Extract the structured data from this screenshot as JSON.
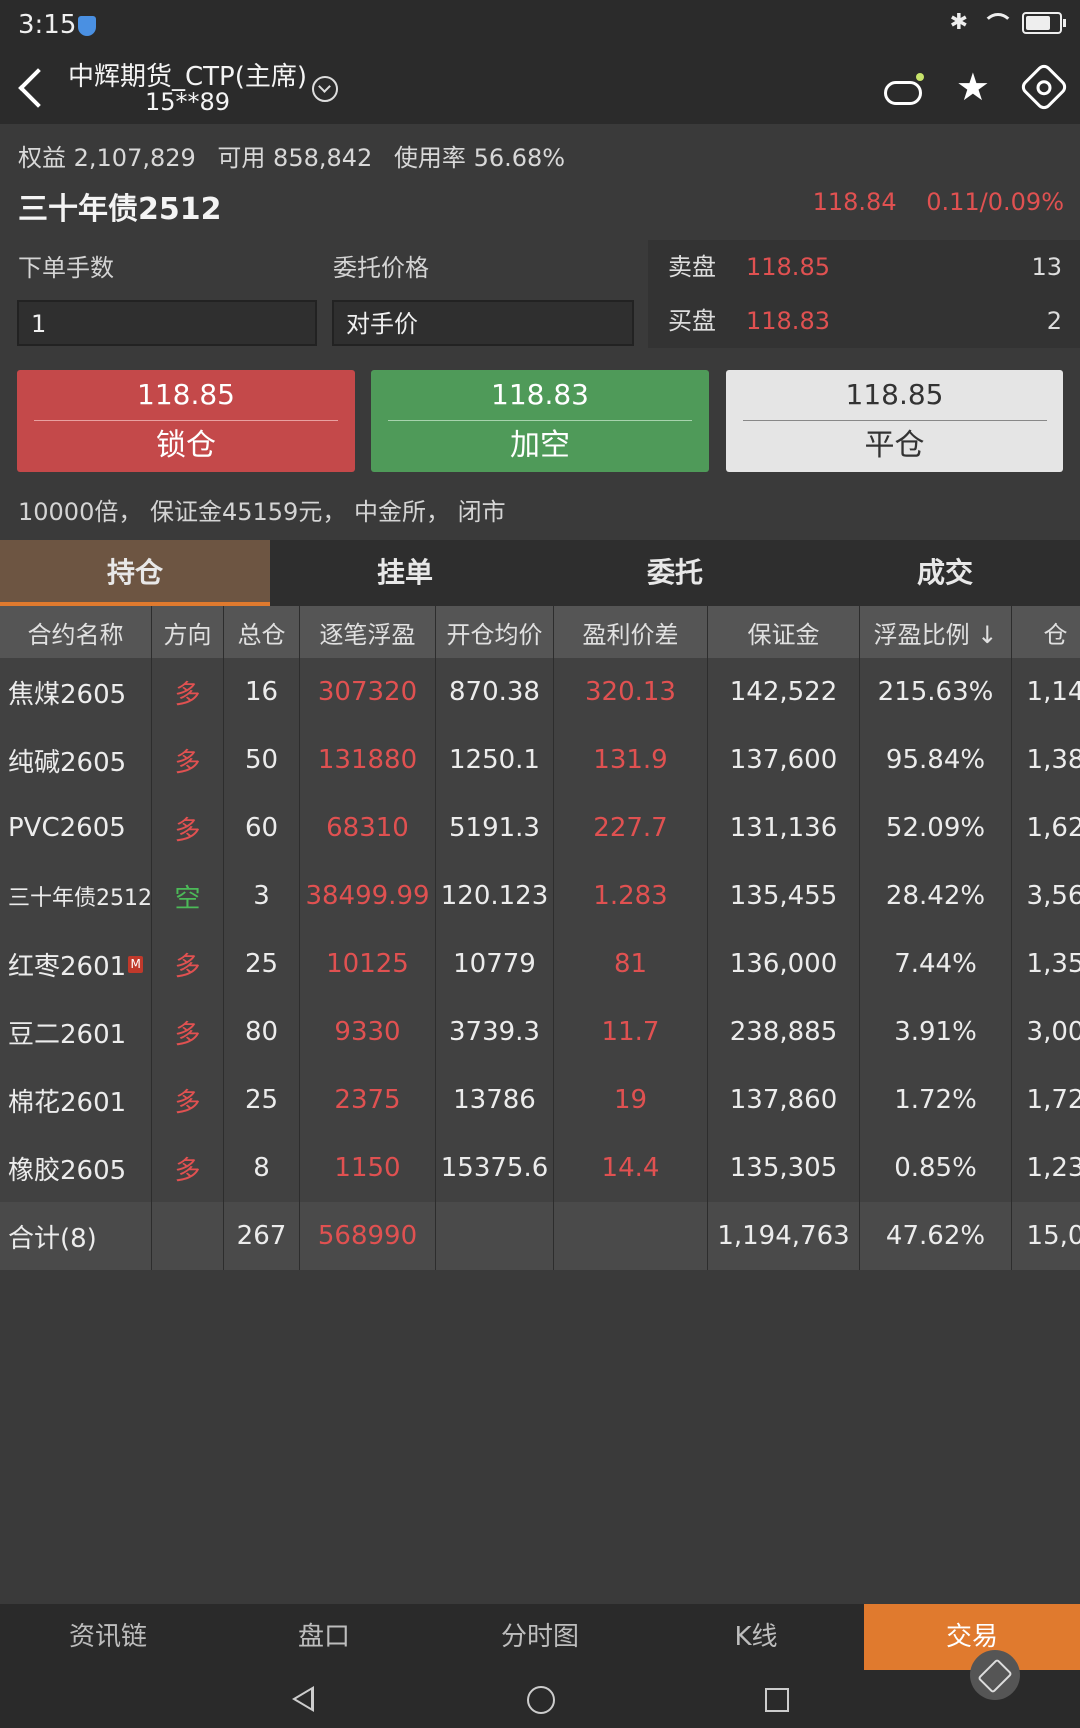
{
  "status": {
    "time": "3:15"
  },
  "nav": {
    "account_name": "中辉期货_CTP(主席)",
    "account_id": "15**89"
  },
  "account": {
    "equity": "权益 2,107,829",
    "available": "可用 858,842",
    "usage": "使用率 56.68%"
  },
  "contract": {
    "name": "三十年债2512",
    "last": "118.84",
    "change": "0.11/0.09%"
  },
  "order": {
    "lots_label": "下单手数",
    "price_label": "委托价格",
    "lots_value": "1",
    "price_value": "对手价"
  },
  "orderbook": {
    "ask": {
      "label": "卖盘",
      "price": "118.85",
      "volume": "13"
    },
    "bid": {
      "label": "买盘",
      "price": "118.83",
      "volume": "2"
    }
  },
  "buttons": {
    "lock": {
      "price": "118.85",
      "label": "锁仓"
    },
    "short": {
      "price": "118.83",
      "label": "加空"
    },
    "close": {
      "price": "118.85",
      "label": "平仓"
    }
  },
  "info": "10000倍， 保证金45159元， 中金所， 闭市",
  "tabs": [
    "持仓",
    "挂单",
    "委托",
    "成交"
  ],
  "table": {
    "headers": [
      "合约名称",
      "方向",
      "总仓",
      "逐笔浮盈",
      "开仓均价",
      "盈利价差",
      "保证金",
      "浮盈比例 ↓",
      "仓"
    ],
    "rows": [
      [
        "焦煤2605",
        "多",
        "16",
        "307320",
        "870.38",
        "320.13",
        "142,522",
        "215.63%",
        "1,14"
      ],
      [
        "纯碱2605",
        "多",
        "50",
        "131880",
        "1250.1",
        "131.9",
        "137,600",
        "95.84%",
        "1,38"
      ],
      [
        "PVC2605",
        "多",
        "60",
        "68310",
        "5191.3",
        "227.7",
        "131,136",
        "52.09%",
        "1,62"
      ],
      [
        "三十年债2512",
        "空",
        "3",
        "38499.99",
        "120.123",
        "1.283",
        "135,455",
        "28.42%",
        "3,56"
      ],
      [
        "红枣2601",
        "多",
        "25",
        "10125",
        "10779",
        "81",
        "136,000",
        "7.44%",
        "1,35"
      ],
      [
        "豆二2601",
        "多",
        "80",
        "9330",
        "3739.3",
        "11.7",
        "238,885",
        "3.91%",
        "3,00"
      ],
      [
        "棉花2601",
        "多",
        "25",
        "2375",
        "13786",
        "19",
        "137,860",
        "1.72%",
        "1,72"
      ],
      [
        "橡胶2605",
        "多",
        "8",
        "1150",
        "15375.6",
        "14.4",
        "135,305",
        "0.85%",
        "1,23"
      ]
    ],
    "total": [
      "合计(8)",
      "",
      "267",
      "568990",
      "",
      "",
      "1,194,763",
      "47.62%",
      "15,0"
    ],
    "m_badge": "M"
  },
  "bottom_nav": [
    "资讯链",
    "盘口",
    "分时图",
    "K线",
    "交易"
  ],
  "colors": {
    "up": "#e05151",
    "down": "#4cba58",
    "accent": "#e07a2e"
  }
}
